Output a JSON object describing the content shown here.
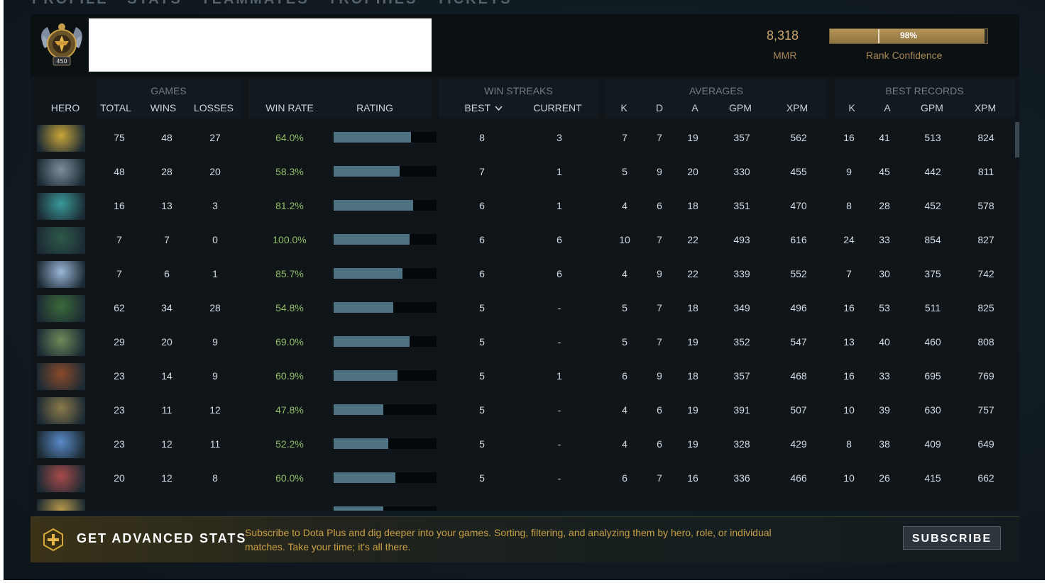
{
  "breadcrumbs": [
    "PROFILE",
    "STATS",
    "TEAMMATES",
    "TROPHIES",
    "TICKETS"
  ],
  "header": {
    "rank_badge_number": "450",
    "mmr_value": "8,318",
    "mmr_label": "MMR",
    "rank_confidence_percent": 98,
    "rank_confidence_text": "98%",
    "rank_confidence_label": "Rank Confidence"
  },
  "column_groups": {
    "games": "GAMES",
    "win_streaks": "WIN STREAKS",
    "averages": "AVERAGES",
    "best_records": "BEST RECORDS"
  },
  "columns": {
    "hero": "HERO",
    "total": "TOTAL",
    "wins": "WINS",
    "losses": "LOSSES",
    "win_rate": "WIN RATE",
    "rating": "RATING",
    "best": "BEST",
    "current": "CURRENT",
    "k": "K",
    "d": "D",
    "a": "A",
    "gpm": "GPM",
    "xpm": "XPM",
    "best_k": "K",
    "best_a": "A",
    "best_gpm": "GPM",
    "best_xpm": "XPM"
  },
  "rows": [
    {
      "hero_icon": "hero-portrait-1",
      "color": "#c9a63a",
      "total": "75",
      "wins": "48",
      "losses": "27",
      "win_rate": "64.0%",
      "rating": 0.75,
      "best": "8",
      "current": "3",
      "k": "7",
      "d": "7",
      "a": "19",
      "gpm": "357",
      "xpm": "562",
      "bk": "16",
      "ba": "41",
      "bgpm": "513",
      "bxpm": "824"
    },
    {
      "hero_icon": "hero-portrait-2",
      "color": "#7f8e9d",
      "total": "48",
      "wins": "28",
      "losses": "20",
      "win_rate": "58.3%",
      "rating": 0.64,
      "best": "7",
      "current": "1",
      "k": "5",
      "d": "9",
      "a": "20",
      "gpm": "330",
      "xpm": "455",
      "bk": "9",
      "ba": "45",
      "bgpm": "442",
      "bxpm": "811"
    },
    {
      "hero_icon": "hero-portrait-3",
      "color": "#3a9a9a",
      "total": "16",
      "wins": "13",
      "losses": "3",
      "win_rate": "81.2%",
      "rating": 0.77,
      "best": "6",
      "current": "1",
      "k": "4",
      "d": "6",
      "a": "18",
      "gpm": "351",
      "xpm": "470",
      "bk": "8",
      "ba": "28",
      "bgpm": "452",
      "bxpm": "578"
    },
    {
      "hero_icon": "hero-portrait-4",
      "color": "#2d5a4a",
      "total": "7",
      "wins": "7",
      "losses": "0",
      "win_rate": "100.0%",
      "rating": 0.74,
      "best": "6",
      "current": "6",
      "k": "10",
      "d": "7",
      "a": "22",
      "gpm": "493",
      "xpm": "616",
      "bk": "24",
      "ba": "33",
      "bgpm": "854",
      "bxpm": "827"
    },
    {
      "hero_icon": "hero-portrait-5",
      "color": "#9ab6d8",
      "total": "7",
      "wins": "6",
      "losses": "1",
      "win_rate": "85.7%",
      "rating": 0.67,
      "best": "6",
      "current": "6",
      "k": "4",
      "d": "9",
      "a": "22",
      "gpm": "339",
      "xpm": "552",
      "bk": "7",
      "ba": "30",
      "bgpm": "375",
      "bxpm": "742"
    },
    {
      "hero_icon": "hero-portrait-6",
      "color": "#3a6a3a",
      "total": "62",
      "wins": "34",
      "losses": "28",
      "win_rate": "54.8%",
      "rating": 0.58,
      "best": "5",
      "current": "-",
      "k": "5",
      "d": "7",
      "a": "18",
      "gpm": "349",
      "xpm": "496",
      "bk": "16",
      "ba": "53",
      "bgpm": "511",
      "bxpm": "825"
    },
    {
      "hero_icon": "hero-portrait-7",
      "color": "#6e8a5a",
      "total": "29",
      "wins": "20",
      "losses": "9",
      "win_rate": "69.0%",
      "rating": 0.74,
      "best": "5",
      "current": "-",
      "k": "5",
      "d": "7",
      "a": "19",
      "gpm": "352",
      "xpm": "547",
      "bk": "13",
      "ba": "40",
      "bgpm": "460",
      "bxpm": "808"
    },
    {
      "hero_icon": "hero-portrait-8",
      "color": "#8a4a2a",
      "total": "23",
      "wins": "14",
      "losses": "9",
      "win_rate": "60.9%",
      "rating": 0.62,
      "best": "5",
      "current": "1",
      "k": "6",
      "d": "9",
      "a": "18",
      "gpm": "357",
      "xpm": "468",
      "bk": "16",
      "ba": "33",
      "bgpm": "695",
      "bxpm": "769"
    },
    {
      "hero_icon": "hero-portrait-9",
      "color": "#8a7a4a",
      "total": "23",
      "wins": "11",
      "losses": "12",
      "win_rate": "47.8%",
      "rating": 0.48,
      "best": "5",
      "current": "-",
      "k": "4",
      "d": "6",
      "a": "19",
      "gpm": "391",
      "xpm": "507",
      "bk": "10",
      "ba": "39",
      "bgpm": "630",
      "bxpm": "757"
    },
    {
      "hero_icon": "hero-portrait-10",
      "color": "#5a8ac8",
      "total": "23",
      "wins": "12",
      "losses": "11",
      "win_rate": "52.2%",
      "rating": 0.53,
      "best": "5",
      "current": "-",
      "k": "4",
      "d": "6",
      "a": "19",
      "gpm": "328",
      "xpm": "429",
      "bk": "8",
      "ba": "38",
      "bgpm": "409",
      "bxpm": "649"
    },
    {
      "hero_icon": "hero-portrait-11",
      "color": "#a84a4a",
      "total": "20",
      "wins": "12",
      "losses": "8",
      "win_rate": "60.0%",
      "rating": 0.6,
      "best": "5",
      "current": "-",
      "k": "6",
      "d": "7",
      "a": "16",
      "gpm": "336",
      "xpm": "466",
      "bk": "10",
      "ba": "26",
      "bgpm": "415",
      "bxpm": "662"
    },
    {
      "hero_icon": "hero-portrait-12",
      "color": "#b89a4a",
      "total": "",
      "wins": "",
      "losses": "",
      "win_rate": "",
      "rating": 0.48,
      "best": "",
      "current": "",
      "k": "",
      "d": "",
      "a": "",
      "gpm": "",
      "xpm": "",
      "bk": "",
      "ba": "",
      "bgpm": "",
      "bxpm": ""
    }
  ],
  "promo": {
    "title": "GET ADVANCED STATS",
    "text": "Subscribe to Dota Plus and dig deeper into your games. Sorting, filtering, and analyzing them by hero, role, or individual matches. Take your time; it's all there.",
    "button": "SUBSCRIBE"
  }
}
